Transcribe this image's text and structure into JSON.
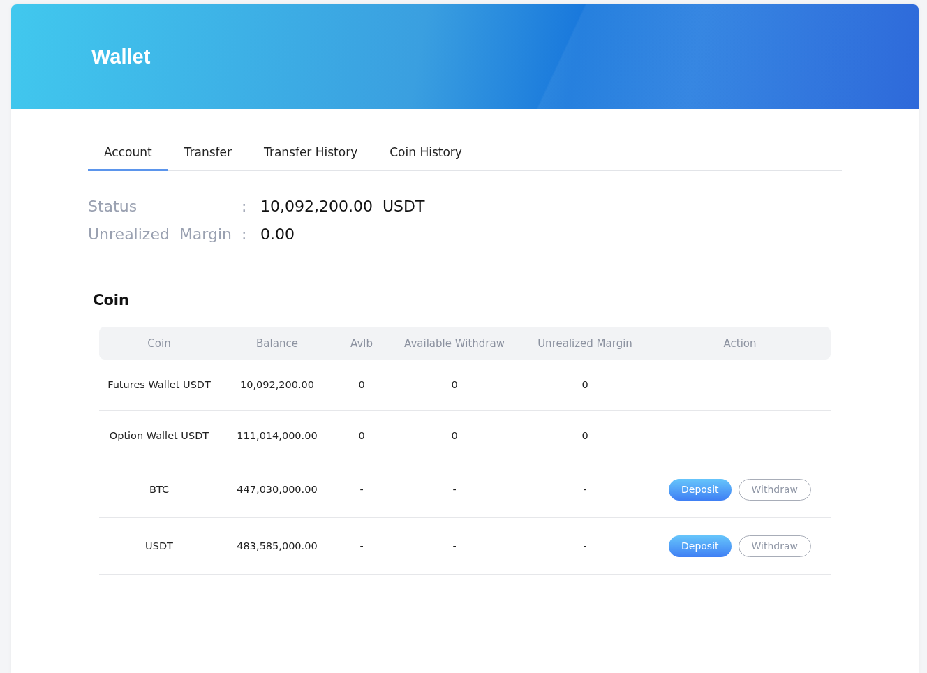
{
  "header": {
    "title": "Wallet"
  },
  "tabs": [
    {
      "label": "Account",
      "selected": true
    },
    {
      "label": "Transfer",
      "selected": false
    },
    {
      "label": "Transfer History",
      "selected": false
    },
    {
      "label": "Coin History",
      "selected": false
    }
  ],
  "summary": [
    {
      "label": "Status",
      "separator": ":",
      "value": "10,092,200.00  USDT"
    },
    {
      "label": "Unrealized  Margin",
      "separator": ":",
      "value": "0.00"
    }
  ],
  "coin_section": {
    "title": "Coin"
  },
  "table": {
    "columns": [
      "Coin",
      "Balance",
      "Avlb",
      "Available Withdraw",
      "Unrealized Margin",
      "Action"
    ],
    "rows": [
      {
        "cells": [
          "Futures Wallet USDT",
          "10,092,200.00",
          "0",
          "0",
          "0"
        ],
        "actions": []
      },
      {
        "cells": [
          "Option Wallet USDT",
          "111,014,000.00",
          "0",
          "0",
          "0"
        ],
        "actions": []
      },
      {
        "cells": [
          "BTC",
          "447,030,000.00",
          "-",
          "-",
          "-"
        ],
        "actions": [
          {
            "label": "Deposit",
            "kind": "primary"
          },
          {
            "label": "Withdraw",
            "kind": "outline"
          }
        ]
      },
      {
        "cells": [
          "USDT",
          "483,585,000.00",
          "-",
          "-",
          "-"
        ],
        "actions": [
          {
            "label": "Deposit",
            "kind": "primary"
          },
          {
            "label": "Withdraw",
            "kind": "outline"
          }
        ]
      }
    ]
  }
}
